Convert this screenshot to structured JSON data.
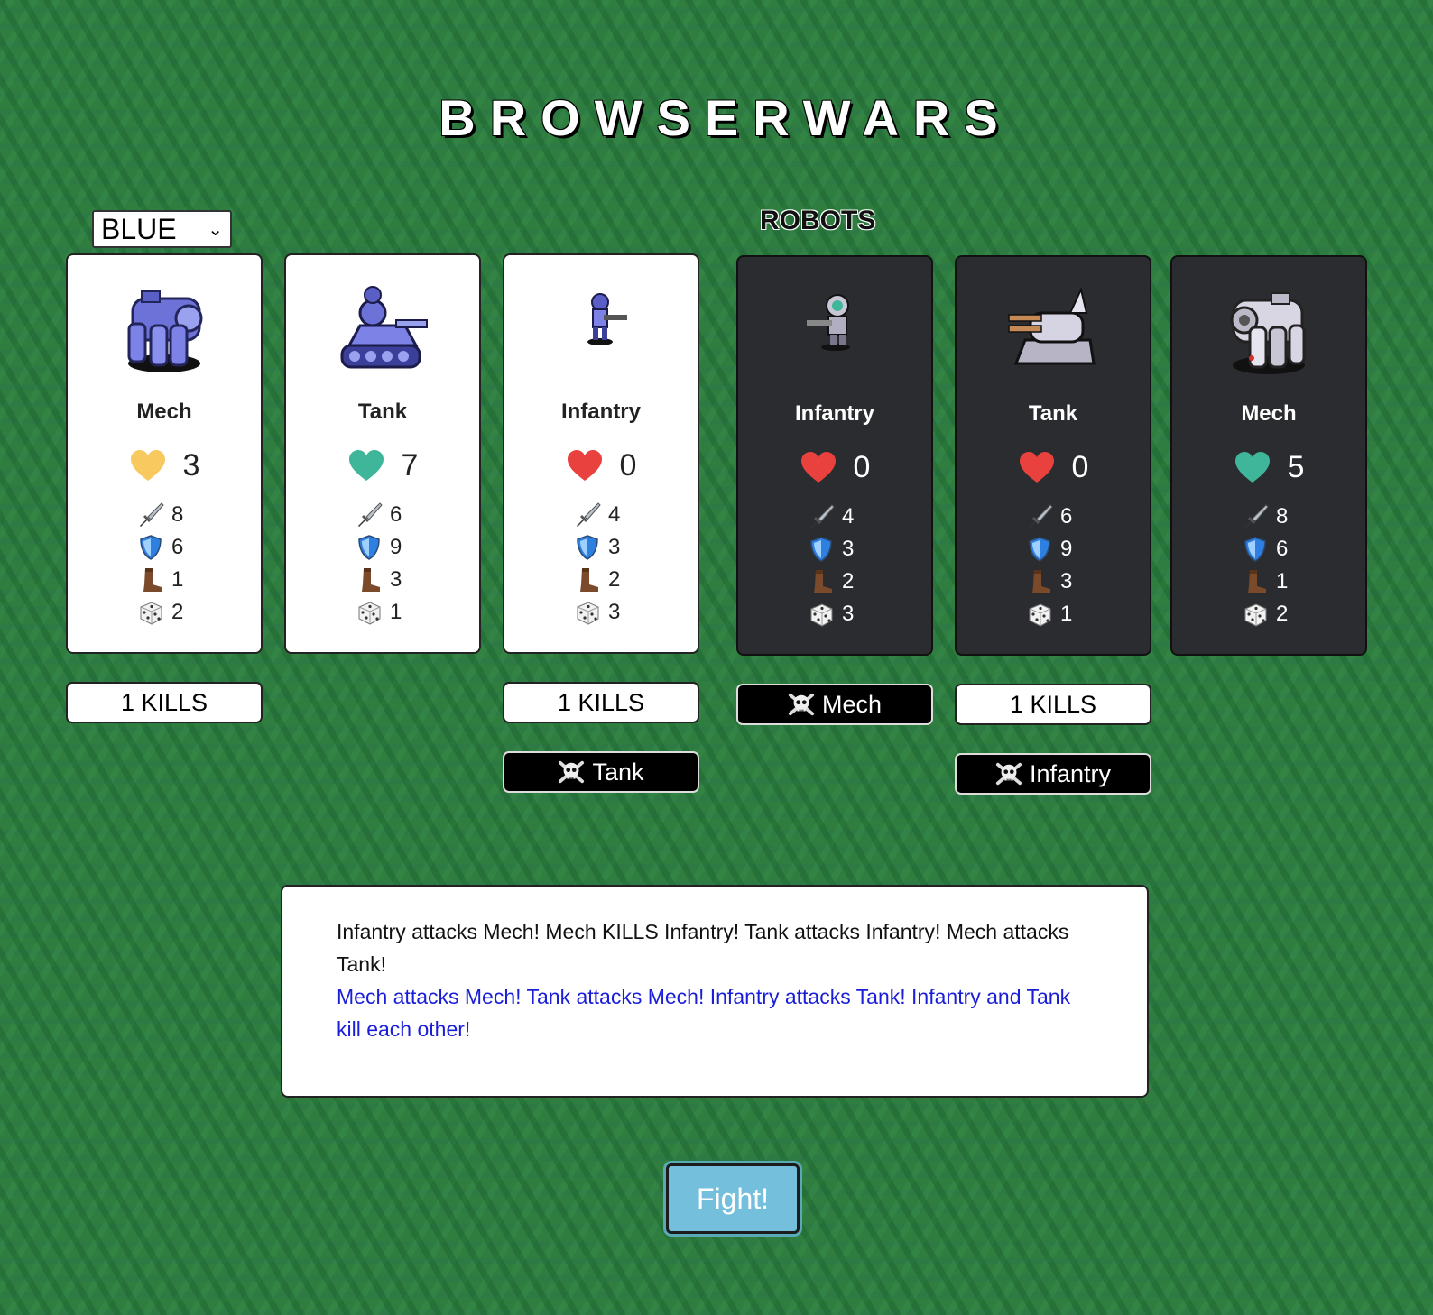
{
  "title": "BROWSERWARS",
  "team_select": {
    "value": "BLUE"
  },
  "robots_label": "ROBOTS",
  "player_units": [
    {
      "name": "Mech",
      "hp": "3",
      "heart_color": "#f7c95e",
      "attack": "8",
      "defense": "6",
      "move": "1",
      "luck": "2",
      "sprite": "blue-mech-sprite"
    },
    {
      "name": "Tank",
      "hp": "7",
      "heart_color": "#3fb59a",
      "attack": "6",
      "defense": "9",
      "move": "3",
      "luck": "1",
      "sprite": "blue-tank-sprite"
    },
    {
      "name": "Infantry",
      "hp": "0",
      "heart_color": "#e8413e",
      "attack": "4",
      "defense": "3",
      "move": "2",
      "luck": "3",
      "sprite": "blue-infantry-sprite"
    }
  ],
  "robot_units": [
    {
      "name": "Infantry",
      "hp": "0",
      "heart_color": "#e8413e",
      "attack": "4",
      "defense": "3",
      "move": "2",
      "luck": "3",
      "sprite": "robot-infantry-sprite"
    },
    {
      "name": "Tank",
      "hp": "0",
      "heart_color": "#e8413e",
      "attack": "6",
      "defense": "9",
      "move": "3",
      "luck": "1",
      "sprite": "robot-tank-sprite"
    },
    {
      "name": "Mech",
      "hp": "5",
      "heart_color": "#3fb59a",
      "attack": "8",
      "defense": "6",
      "move": "1",
      "luck": "2",
      "sprite": "robot-mech-sprite"
    }
  ],
  "badges": {
    "player_mech_kills": "1 KILLS",
    "player_infantry_kills": "1 KILLS",
    "player_infantry_killed_by": "Tank",
    "robot_infantry_killed_by": "Mech",
    "robot_tank_kills": "1 KILLS",
    "robot_tank_killed_by": "Infantry"
  },
  "log": {
    "line1": "Infantry attacks Mech! Mech KILLS Infantry! Tank attacks Infantry! Mech attacks Tank!",
    "line2": "Mech attacks Mech! Tank attacks Mech! Infantry attacks Tank! Infantry and Tank kill each other!"
  },
  "fight_button": "Fight!",
  "colors": {
    "log_highlight": "#1a1ed8",
    "fight_button": "#74bfdc",
    "robot_card": "#2b2c2f"
  }
}
